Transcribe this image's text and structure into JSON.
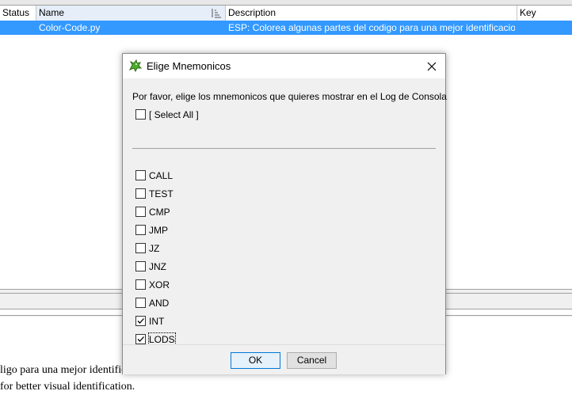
{
  "table": {
    "columns": [
      "Status",
      "Name",
      "Description",
      "Key"
    ],
    "selected_row": {
      "status": "",
      "name": "Color-Code.py",
      "description": "ESP: Colorea algunas partes del codigo para una mejor identificacion vi...",
      "key": ""
    }
  },
  "detail": {
    "line1": "ligo para una mejor identificacion visual.",
    "line2": "for better visual identification."
  },
  "dialog": {
    "title": "Elige Mnemonicos",
    "prompt": "Por favor, elige los mnemonicos que quieres mostrar en el Log de Consola",
    "select_all": {
      "label": "[ Select All ]",
      "checked": false
    },
    "options": [
      {
        "label": "CALL",
        "checked": false
      },
      {
        "label": "TEST",
        "checked": false
      },
      {
        "label": "CMP",
        "checked": false
      },
      {
        "label": "JMP",
        "checked": false
      },
      {
        "label": "JZ",
        "checked": false
      },
      {
        "label": "JNZ",
        "checked": false
      },
      {
        "label": "XOR",
        "checked": false
      },
      {
        "label": "AND",
        "checked": false
      },
      {
        "label": "INT",
        "checked": true
      },
      {
        "label": "LODS",
        "checked": true
      }
    ],
    "ok_label": "OK",
    "cancel_label": "Cancel"
  },
  "colors": {
    "selection": "#3399ff",
    "default_button_border": "#0078d7",
    "icon_green": "#4caf2a"
  },
  "icons": {
    "title": "dragon-icon",
    "close": "close-icon",
    "sort": "sort-icon"
  }
}
